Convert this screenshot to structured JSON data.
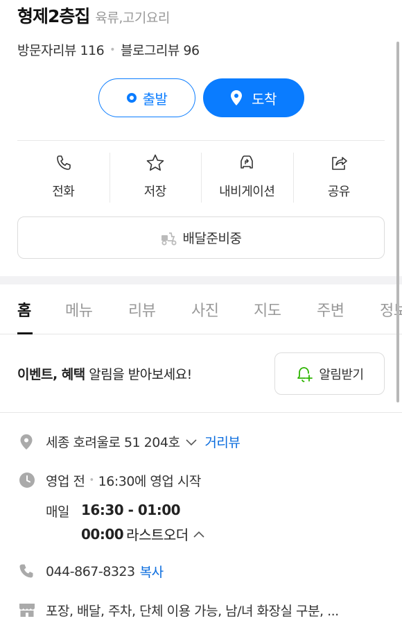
{
  "place": {
    "name": "형제2층집",
    "category": "육류,고기요리",
    "visitor_reviews": "방문자리뷰 116",
    "blog_reviews": "블로그리뷰 96"
  },
  "route": {
    "depart_label": "출발",
    "arrive_label": "도착"
  },
  "actions": [
    {
      "label": "전화",
      "icon": "phone-icon"
    },
    {
      "label": "저장",
      "icon": "star-icon"
    },
    {
      "label": "내비게이션",
      "icon": "navigation-icon"
    },
    {
      "label": "공유",
      "icon": "share-icon"
    }
  ],
  "delivery": {
    "label": "배달준비중",
    "icon": "delivery-scooter-icon"
  },
  "tabs": [
    "홈",
    "메뉴",
    "리뷰",
    "사진",
    "지도",
    "주변",
    "정보"
  ],
  "event": {
    "bold": "이벤트, 혜택",
    "rest": " 알림을 받아보세요!",
    "button": "알림받기"
  },
  "info": {
    "address": "세종 호려울로 51 204호",
    "distance_link": "거리뷰",
    "status": "영업 전",
    "status_detail": "16:30에 영업 시작",
    "hours_day": "매일",
    "hours_time": "16:30 - 01:00",
    "last_order_time": "00:00",
    "last_order_label": "라스트오더",
    "phone": "044-867-8323",
    "copy_label": "복사",
    "amenities": "포장, 배달, 주차, 단체 이용 가능, 남/녀 화장실 구분, ..."
  },
  "colors": {
    "accent": "#0a7cff",
    "link": "#0a6cde",
    "notify_green": "#2db400",
    "muted": "#999999"
  }
}
